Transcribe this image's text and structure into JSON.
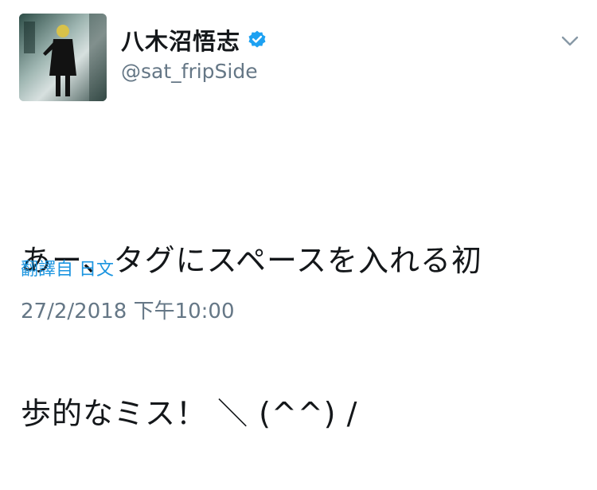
{
  "user": {
    "display_name": "八木沼悟志",
    "handle": "@sat_fripSide",
    "verified_icon": "verified-badge-icon"
  },
  "tweet": {
    "line1": "あー、タグにスペースを入れる初",
    "line2": "歩的なミス！ ＼ (^^) /",
    "translate_label": "翻譯自 日文",
    "timestamp": "27/2/2018 下午10:00"
  },
  "colors": {
    "link_blue": "#1b95e0",
    "secondary_gray": "#657786",
    "verified_blue": "#1da1f2"
  }
}
